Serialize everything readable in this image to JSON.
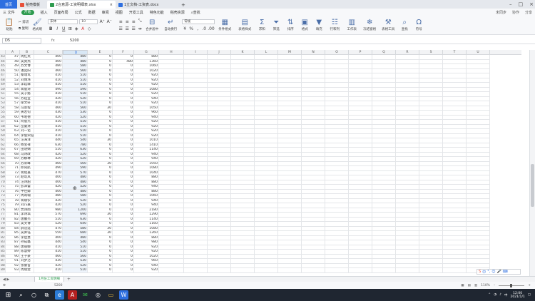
{
  "tabs": {
    "home": "首页",
    "t1": "稻壳模板",
    "t2": "2合意源-工资明细表.xlsx",
    "t3": "1立文档-工资表.docx",
    "new": "+"
  },
  "menu": {
    "items": [
      "三 文件",
      "开始",
      "插入",
      "页面布局",
      "公式",
      "数据",
      "审阅",
      "视图",
      "开发工具",
      "特色功能",
      "稻壳资源"
    ],
    "active": "开始",
    "search": "查找",
    "right": [
      "未同步",
      "协作",
      "分享"
    ]
  },
  "toolbar": {
    "paste": "粘贴",
    "cut": "剪切",
    "copy": "复制",
    "format_painter": "格式刷",
    "font": "宋体",
    "size": "10",
    "merge": "合并居中",
    "wrap": "自动换行",
    "number_format": "常规",
    "cond_format": "条件格式",
    "table_style": "表格样式",
    "sum": "求和",
    "filter": "筛选",
    "sort": "排序",
    "format": "格式",
    "fill": "填充",
    "rowcol": "行和列",
    "worksheet": "工作表",
    "freeze": "冻结窗格",
    "tools": "表格工具",
    "find": "查找",
    "symbol": "符号"
  },
  "formula_bar": {
    "name_box": "D5",
    "fx": "fx",
    "value": "5200"
  },
  "columns": [
    "A",
    "B",
    "C",
    "D",
    "E",
    "F",
    "G",
    "H",
    "I",
    "J",
    "K",
    "L",
    "M",
    "N",
    "O",
    "P",
    "Q",
    "R",
    "S",
    "T",
    "U"
  ],
  "selected_column": "D",
  "rows": [
    [
      "43",
      "47",
      "周红英",
      "400",
      "480",
      "0",
      "0",
      "880"
    ],
    [
      "44",
      "48",
      "吴莫燕",
      "400",
      "480",
      "0",
      "480",
      "1360"
    ],
    [
      "45",
      "49",
      "苏文博",
      "480",
      "580",
      "0",
      "0",
      "1060"
    ],
    [
      "46",
      "50",
      "潘奕阳",
      "460",
      "560",
      "0",
      "0",
      "1020"
    ],
    [
      "47",
      "51",
      "秦瑞鸳",
      "410",
      "510",
      "0",
      "0",
      "920"
    ],
    [
      "48",
      "52",
      "刘博玮",
      "410",
      "510",
      "0",
      "0",
      "920"
    ],
    [
      "49",
      "53",
      "李廷霖",
      "410",
      "510",
      "0",
      "0",
      "920"
    ],
    [
      "50",
      "54",
      "蒋俊涛",
      "490",
      "590",
      "0",
      "0",
      "1080"
    ],
    [
      "51",
      "55",
      "吴子懿",
      "410",
      "510",
      "0",
      "0",
      "920"
    ],
    [
      "52",
      "56",
      "苏廷宣",
      "420",
      "520",
      "0",
      "0",
      "940"
    ],
    [
      "53",
      "57",
      "郁文轩",
      "410",
      "510",
      "0",
      "0",
      "920"
    ],
    [
      "54",
      "58",
      "冯景程",
      "460",
      "560",
      "30",
      "0",
      "1050"
    ],
    [
      "55",
      "59",
      "黄若钧",
      "430",
      "530",
      "0",
      "0",
      "960"
    ],
    [
      "56",
      "60",
      "韦昭德",
      "420",
      "520",
      "0",
      "0",
      "940"
    ],
    [
      "57",
      "61",
      "阿俊杰",
      "410",
      "510",
      "0",
      "0",
      "920"
    ],
    [
      "58",
      "62",
      "岳曼清",
      "410",
      "510",
      "0",
      "0",
      "920"
    ],
    [
      "59",
      "63",
      "刘一诺",
      "410",
      "510",
      "0",
      "0",
      "920"
    ],
    [
      "60",
      "64",
      "李俊荣倍",
      "410",
      "510",
      "0",
      "0",
      "920"
    ],
    [
      "61",
      "65",
      "汪海洋",
      "440",
      "540",
      "30",
      "0",
      "1010"
    ],
    [
      "62",
      "66",
      "杨宝祥",
      "630",
      "780",
      "0",
      "0",
      "1410"
    ],
    [
      "63",
      "67",
      "田语娴",
      "510",
      "630",
      "0",
      "0",
      "1140"
    ],
    [
      "64",
      "68",
      "冯诗政",
      "420",
      "520",
      "0",
      "0",
      "940"
    ],
    [
      "65",
      "69",
      "苏娜琳",
      "420",
      "520",
      "0",
      "0",
      "940"
    ],
    [
      "66",
      "70",
      "苏荣峰",
      "460",
      "560",
      "30",
      "0",
      "1050"
    ],
    [
      "67",
      "71",
      "邱同航",
      "490",
      "590",
      "0",
      "0",
      "1080"
    ],
    [
      "68",
      "72",
      "蒋绍嘉",
      "470",
      "570",
      "0",
      "0",
      "1040"
    ],
    [
      "69",
      "73",
      "赵筑岚",
      "400",
      "480",
      "0",
      "0",
      "880"
    ],
    [
      "70",
      "74",
      "汪诗甜",
      "400",
      "480",
      "0",
      "0",
      "880"
    ],
    [
      "71",
      "75",
      "彭泽蕾",
      "420",
      "520",
      "0",
      "0",
      "940"
    ],
    [
      "72",
      "76",
      "申佳卿",
      "400",
      "480",
      "0",
      "0",
      "880"
    ],
    [
      "73",
      "77",
      "周奇翰",
      "480",
      "580",
      "0",
      "0",
      "1060"
    ],
    [
      "74",
      "78",
      "蒋轶钦",
      "420",
      "520",
      "0",
      "0",
      "940"
    ],
    [
      "75",
      "79",
      "刘乃嘉",
      "420",
      "520",
      "0",
      "0",
      "940"
    ],
    [
      "76",
      "80",
      "贾诗雨",
      "980",
      "1200",
      "0",
      "0",
      "2180"
    ],
    [
      "77",
      "81",
      "李诗琪",
      "570",
      "690",
      "30",
      "0",
      "1290"
    ],
    [
      "78",
      "82",
      "唐馨杰",
      "510",
      "630",
      "0",
      "0",
      "1140"
    ],
    [
      "79",
      "83",
      "吴文博",
      "520",
      "640",
      "0",
      "0",
      "1160"
    ],
    [
      "80",
      "84",
      "薛冠廷",
      "470",
      "580",
      "30",
      "0",
      "1080"
    ],
    [
      "81",
      "85",
      "吴霁钰",
      "550",
      "680",
      "30",
      "0",
      "1260"
    ],
    [
      "82",
      "86",
      "李启慧",
      "400",
      "480",
      "0",
      "0",
      "880"
    ],
    [
      "83",
      "87",
      "孙成磊",
      "440",
      "540",
      "0",
      "0",
      "980"
    ],
    [
      "84",
      "88",
      "唐丽娜",
      "410",
      "510",
      "0",
      "0",
      "920"
    ],
    [
      "85",
      "89",
      "陈慧婷",
      "410",
      "510",
      "0",
      "0",
      "920"
    ],
    [
      "86",
      "90",
      "王子豪",
      "460",
      "560",
      "0",
      "0",
      "1020"
    ],
    [
      "87",
      "91",
      "刘梦洁",
      "430",
      "530",
      "0",
      "0",
      "960"
    ],
    [
      "88",
      "92",
      "张睿哲",
      "420",
      "520",
      "0",
      "0",
      "940"
    ],
    [
      "89",
      "93",
      "周晓雯",
      "410",
      "510",
      "0",
      "0",
      "920"
    ]
  ],
  "sheet_tab": "1月份工资明细",
  "status": {
    "left": "5200",
    "zoom": "110%"
  },
  "taskbar": {
    "time": "12:00",
    "date": "2021/1/1"
  },
  "ime": "中",
  "colors": {
    "accent_blue": "#2e6fe0",
    "wps_green": "#2e9b4f",
    "taskbar": "#1f2631"
  }
}
